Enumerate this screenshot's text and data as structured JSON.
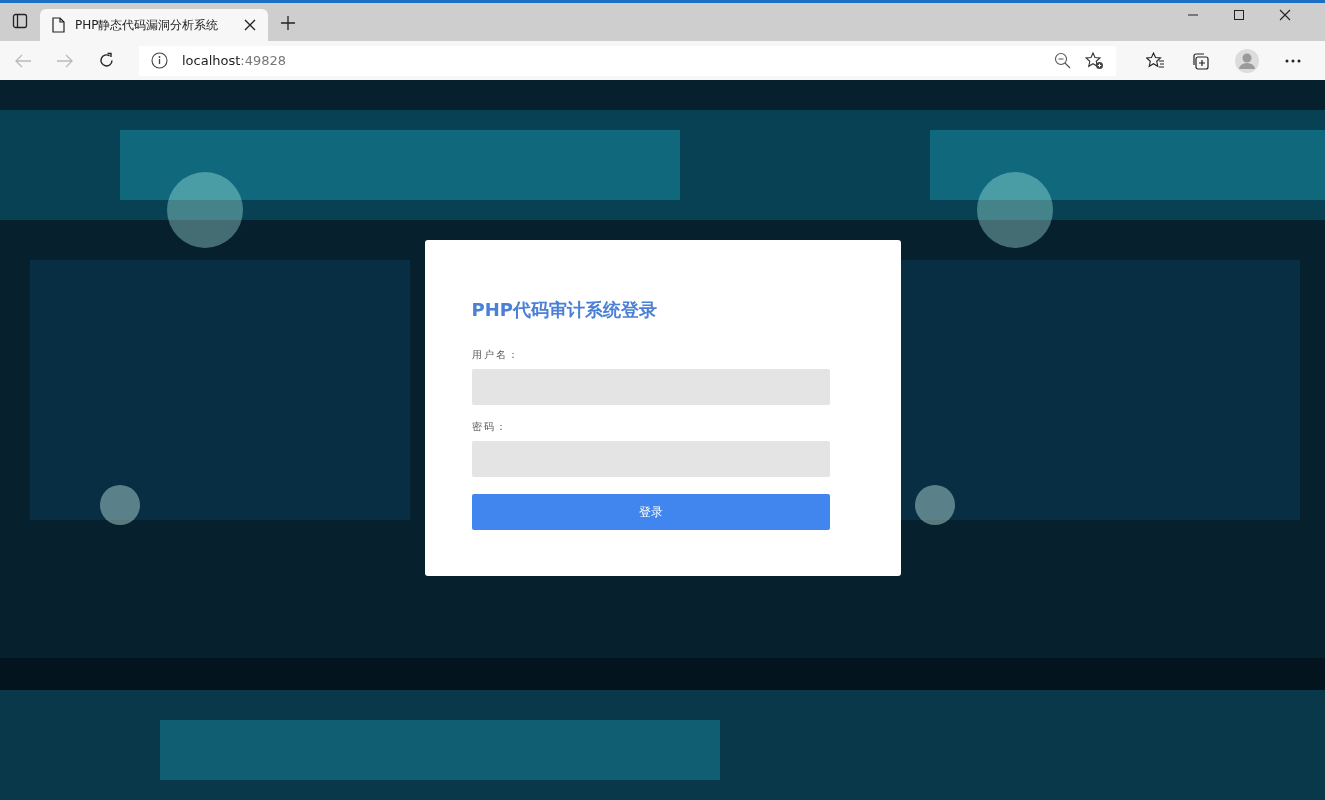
{
  "browser": {
    "tab": {
      "title": "PHP静态代码漏洞分析系统",
      "selected": true
    },
    "address": {
      "host": "localhost",
      "port": ":49828"
    }
  },
  "login": {
    "title": "PHP代码审计系统登录",
    "fields": [
      {
        "label": "用户名："
      },
      {
        "label": "密码："
      }
    ],
    "button": "登录"
  }
}
